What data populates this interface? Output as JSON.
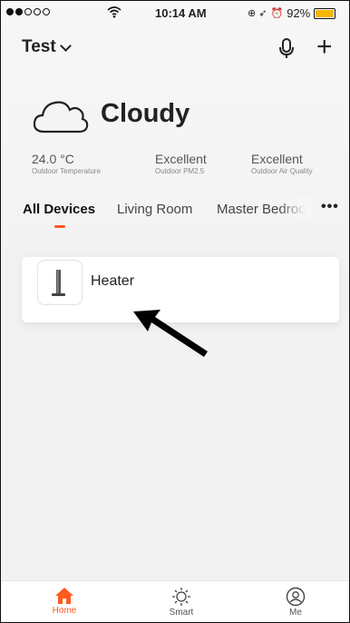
{
  "status_bar": {
    "time": "10:14 AM",
    "battery": "92%",
    "battery_level": 0.92
  },
  "header": {
    "home_name": "Test",
    "mic_icon": "microphone-icon",
    "add_icon": "plus-icon"
  },
  "weather": {
    "condition": "Cloudy",
    "icon": "cloud-icon",
    "stats": [
      {
        "value": "24.0 °C",
        "label": "Outdoor Temperature"
      },
      {
        "value": "Excellent",
        "label": "Outdoor PM2.5"
      },
      {
        "value": "Excellent",
        "label": "Outdoor Air Quality"
      }
    ]
  },
  "tabs": {
    "items": [
      "All Devices",
      "Living Room",
      "Master Bedroo"
    ],
    "active": "All Devices",
    "more": "•••"
  },
  "devices": [
    {
      "name": "Heater",
      "icon": "heater-icon"
    }
  ],
  "bottom_nav": [
    {
      "label": "Home",
      "icon": "home-icon",
      "active": true
    },
    {
      "label": "Smart",
      "icon": "sun-icon",
      "active": false
    },
    {
      "label": "Me",
      "icon": "user-icon",
      "active": false
    }
  ],
  "colors": {
    "accent": "#ff5a1f",
    "battery": "#f5b800"
  }
}
